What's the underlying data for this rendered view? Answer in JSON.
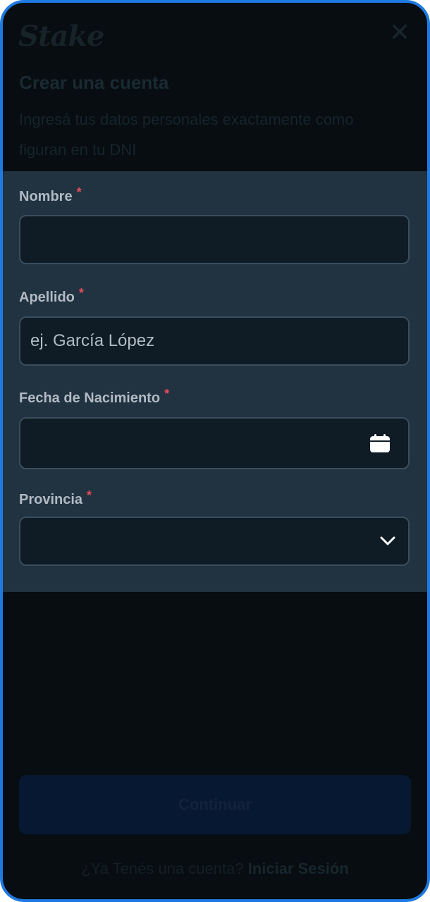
{
  "app": {
    "logo_text": "Stake",
    "close_symbol": "✕"
  },
  "header": {
    "title": "Crear una cuenta",
    "subtitle": "Ingresá tus datos personales exactamente como figuran en tu DNI"
  },
  "form": {
    "fields": [
      {
        "label": "Nombre",
        "required_mark": "*",
        "value": "",
        "placeholder": ""
      },
      {
        "label": "Apellido",
        "required_mark": "*",
        "value": "",
        "placeholder": "ej. García López"
      },
      {
        "label": "Fecha de Nacimiento",
        "required_mark": "*",
        "value": "",
        "icon": "calendar-icon"
      },
      {
        "label": "Provincia",
        "required_mark": "*",
        "value": "",
        "icon": "chevron-down-icon"
      }
    ]
  },
  "footer": {
    "continue_label": "Continuar",
    "login_prompt": "¿Ya Tenés una cuenta?",
    "login_link": "Iniciar Sesión"
  },
  "colors": {
    "accent_border": "#1f7ae0",
    "panel_bg": "#213240",
    "input_bg": "#0f1c25",
    "required": "#e84c5c"
  }
}
